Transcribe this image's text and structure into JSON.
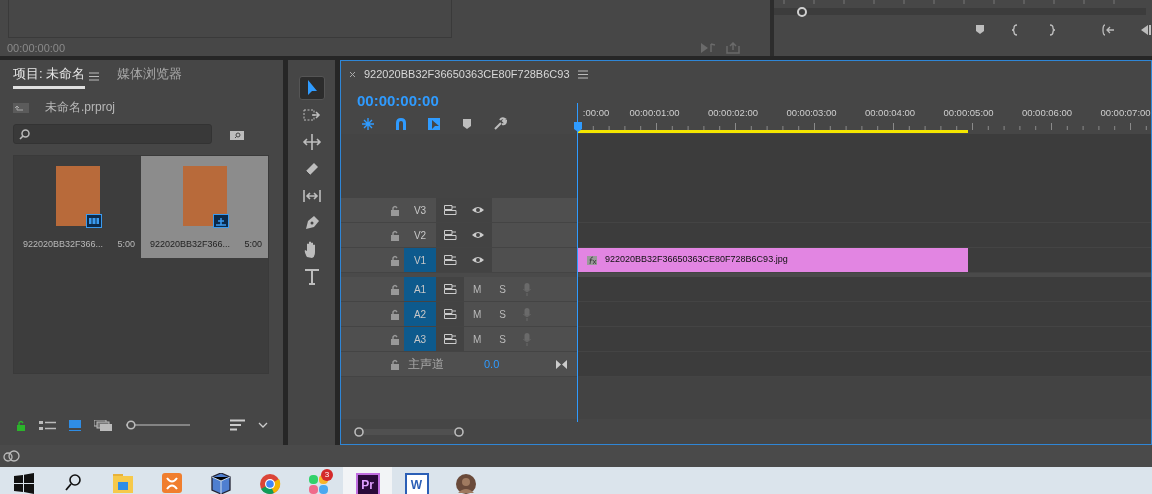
{
  "source_monitor": {
    "timecode": "00:00:00:00"
  },
  "project_panel": {
    "tabs": [
      {
        "label": "项目: 未命名",
        "selected": true
      },
      {
        "label": "媒体浏览器",
        "selected": false
      }
    ],
    "project_file": "未命名.prproj",
    "items": [
      {
        "name": "922020BB32F366...",
        "duration": "5:00",
        "kind": "video",
        "selected": false
      },
      {
        "name": "922020BB32F366...",
        "duration": "5:00",
        "kind": "image",
        "selected": true
      }
    ],
    "zoom_slider": {
      "level": 0
    }
  },
  "tools": [
    {
      "kind": "selection",
      "selected": true
    },
    {
      "kind": "track-select",
      "selected": false
    },
    {
      "kind": "ripple",
      "selected": false
    },
    {
      "kind": "razor",
      "selected": false
    },
    {
      "kind": "slip",
      "selected": false
    },
    {
      "kind": "pen",
      "selected": false
    },
    {
      "kind": "hand",
      "selected": false
    },
    {
      "kind": "type",
      "selected": false
    }
  ],
  "timeline": {
    "sequence_name": "922020BB32F36650363CE80F728B6C93",
    "timecode": "00:00:00:00",
    "ruler_labels": [
      ":00:00",
      "00:00:01:00",
      "00:00:02:00",
      "00:00:03:00",
      "00:00:04:00",
      "00:00:05:00",
      "00:00:06:00",
      "00:00:07:00"
    ],
    "video_tracks": [
      {
        "label": "V3",
        "targeted": false
      },
      {
        "label": "V2",
        "targeted": false
      },
      {
        "label": "V1",
        "targeted": true,
        "clip": {
          "name": "922020BB32F36650363CE80F728B6C93.jpg"
        }
      }
    ],
    "audio_tracks": [
      {
        "label": "A1",
        "targeted": true,
        "mute": "M",
        "solo": "S"
      },
      {
        "label": "A2",
        "targeted": true,
        "mute": "M",
        "solo": "S"
      },
      {
        "label": "A3",
        "targeted": true,
        "mute": "M",
        "solo": "S"
      }
    ],
    "master": {
      "label": "主声道",
      "volume": "0.0"
    }
  },
  "taskbar": {
    "apps": [
      {
        "kind": "start",
        "selected": false
      },
      {
        "kind": "search",
        "selected": false
      },
      {
        "kind": "folder",
        "selected": false
      },
      {
        "kind": "xampp",
        "selected": false
      },
      {
        "kind": "box",
        "selected": false
      },
      {
        "kind": "chrome",
        "selected": false
      },
      {
        "kind": "flower",
        "selected": false,
        "badge": "3"
      },
      {
        "kind": "premiere",
        "selected": true,
        "glyph": "Pr"
      },
      {
        "kind": "word",
        "selected": false,
        "glyph": "W"
      },
      {
        "kind": "avatar",
        "selected": false
      }
    ]
  }
}
